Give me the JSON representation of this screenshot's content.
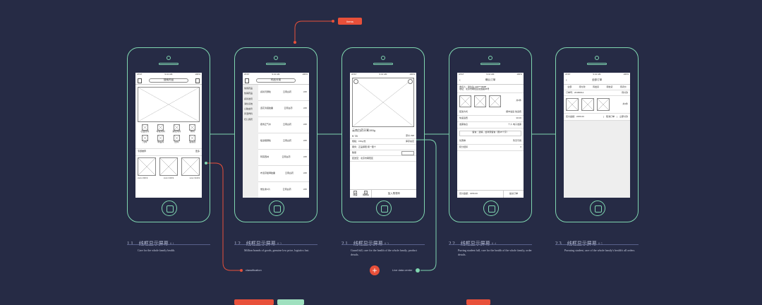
{
  "colors": {
    "bg": "#262b45",
    "line": "#7fd6b0",
    "accent": "#e8503a"
  },
  "tags": {
    "top": "Items",
    "left": "classification",
    "right": "Live data center"
  },
  "phones": [
    {
      "status_carrier": "AT&T",
      "status_time": "9:41 AM",
      "status_battery": "100%",
      "nav_title": "搜索药品",
      "grid_labels": [
        "心血管科",
        "呼吸内科",
        "消化内科",
        "骨科",
        "儿科",
        "中医科",
        "妇科",
        "感冒药",
        "皮肤科"
      ],
      "section": "专题推荐",
      "section_more": "更多",
      "product_label": "xxxx ¥19.9"
    },
    {
      "status_carrier": "AT&T",
      "status_time": "9:41 AM",
      "status_battery": "100%",
      "nav_title": "药品分类",
      "menu": [
        "常用药品",
        "热销药品",
        "感冒发烧",
        "消化系统",
        "心脑血管",
        "风湿骨科",
        "妇儿用药"
      ],
      "items": [
        "感冒灵颗粒",
        "连花清瘟胶囊",
        "藿香正气水",
        "板蓝根颗粒",
        "阿莫西林",
        "布洛芬缓释胶囊",
        "维生素C片"
      ],
      "item_tag": "云南白药",
      "item_price": "¥25"
    },
    {
      "status_carrier": "AT&T",
      "status_time": "9:41 AM",
      "status_battery": "100%",
      "title": "云南白药牙膏150g",
      "price": "¥ 78",
      "price_note": "原价 ¥98",
      "spec": "规格：150g/支",
      "stock": "库存充足",
      "qty_label": "数量",
      "service": "服务：正品保障 假一赔十",
      "delivery": "配送至：北京市朝阳区",
      "fav": "收藏",
      "cart": "购物车",
      "add_cart": "加入购物车"
    },
    {
      "status_carrier": "AT&T",
      "status_time": "9:41 AM",
      "status_battery": "100%",
      "nav_title": "确认订单",
      "addr1": "收货人：张先生 138****8888",
      "addr2": "地址：北京市朝阳区建国路88号",
      "count": "共3件",
      "rows": [
        "配送方式",
        "快递运费",
        "发票信息",
        "优惠券",
        "积分抵扣"
      ],
      "row_vals": [
        "顺丰速运 免运费",
        "¥0.00",
        "个人 电子发票",
        "暂无可用",
        "0"
      ],
      "notice": "留言：选填，给商家留言（限45个字）",
      "total_label": "实付金额：",
      "total": "¥256.00",
      "submit": "提交订单"
    },
    {
      "status_carrier": "AT&T",
      "status_time": "9:41 AM",
      "status_battery": "100%",
      "nav_title": "全部订单",
      "tabs": [
        "全部",
        "待付款",
        "待发货",
        "待收货",
        "待评价"
      ],
      "order_no": "订单号：20180612",
      "order_status": "待付款",
      "count": "共3件",
      "total": "实付金额：¥256.00",
      "cancel": "取消订单",
      "pay": "立即付款"
    }
  ],
  "captions": [
    {
      "num": "1.1",
      "title": "线框显示屏幕",
      "sub": "0.1",
      "desc": "Care for the whole family health."
    },
    {
      "num": "1.2",
      "title": "线框显示屏幕",
      "sub": "0.2",
      "desc": "Million brands of goods, genuine low price, logistics fast."
    },
    {
      "num": "2.1",
      "title": "线框显示屏幕",
      "sub": "0.3",
      "desc": "Guard full, care for the health of the whole family, product details."
    },
    {
      "num": "2.2",
      "title": "线框显示屏幕",
      "sub": "0.4",
      "desc": "Purring student full, care for the health of the whole family, order details."
    },
    {
      "num": "2.3",
      "title": "线框显示屏幕",
      "sub": "0.5",
      "desc": "Pursuing student, care of the whole family's health's all orders."
    }
  ]
}
